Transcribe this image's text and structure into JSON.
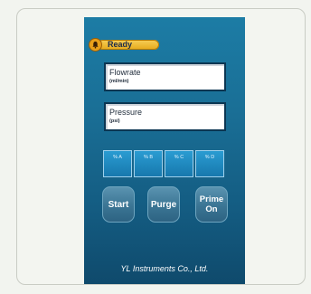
{
  "status": {
    "label": "Ready",
    "color": "#f0bc33"
  },
  "fields": [
    {
      "label": "Flowrate",
      "unit": "(ml/min)"
    },
    {
      "label": "Pressure",
      "unit": "(psi)"
    }
  ],
  "percent_boxes": [
    "% A",
    "% B",
    "% C",
    "% D"
  ],
  "buttons": {
    "start": "Start",
    "purge": "Purge",
    "prime_line1": "Prime",
    "prime_line2": "On"
  },
  "footer": "YL Instruments Co., Ltd.",
  "colors": {
    "panel_top": "#1c7ca5",
    "panel_bottom": "#0f4a6c"
  },
  "icons": {
    "status": "alarm-bell-icon"
  }
}
